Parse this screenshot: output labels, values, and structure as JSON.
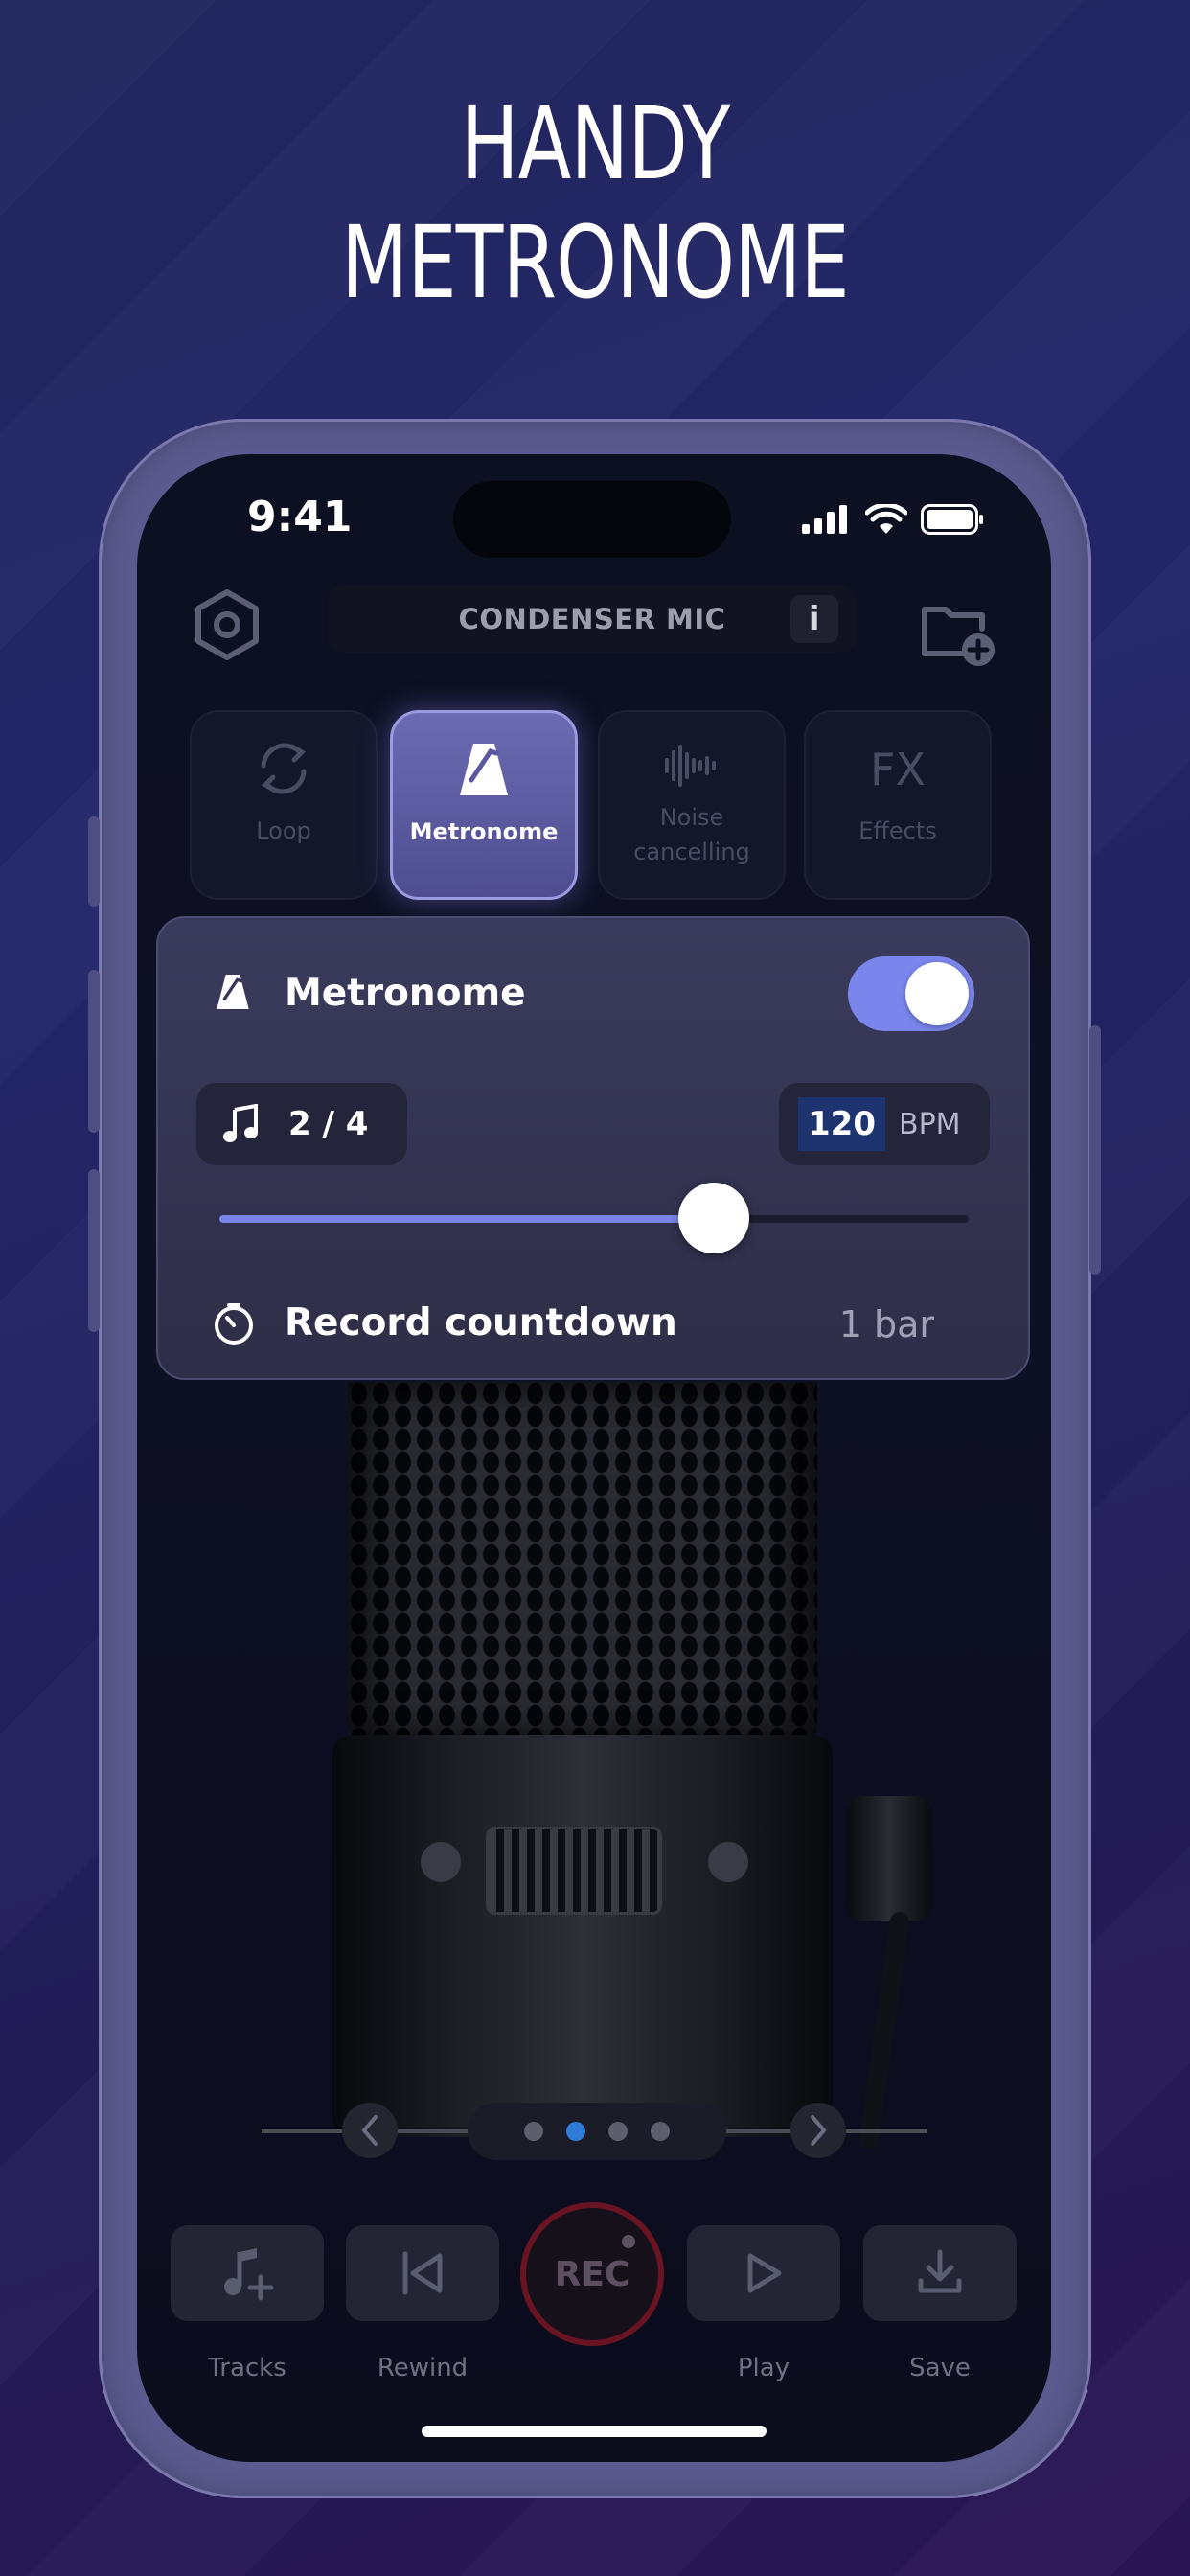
{
  "headline": {
    "line1": "HANDY",
    "line2": "METRONOME"
  },
  "status_bar": {
    "time": "9:41"
  },
  "header": {
    "mic_title": "CONDENSER MIC",
    "info_label": "i"
  },
  "modes": [
    {
      "label": "Loop",
      "icon": "loop-icon",
      "active": false
    },
    {
      "label": "Metronome",
      "icon": "metronome-icon",
      "active": true
    },
    {
      "label": "Noise cancelling",
      "icon": "waveform-icon",
      "active": false
    },
    {
      "label": "Effects",
      "icon": "fx-icon",
      "active": false
    }
  ],
  "metronome_panel": {
    "title": "Metronome",
    "enabled": true,
    "time_signature": "2 / 4",
    "bpm": "120",
    "bpm_unit": "BPM",
    "tempo_slider_fraction": 0.66,
    "countdown_label": "Record countdown",
    "countdown_value": "1 bar"
  },
  "carousel": {
    "page_count": 4,
    "active_index": 1
  },
  "toolbar": {
    "tracks": "Tracks",
    "rewind": "Rewind",
    "rec": "REC",
    "play": "Play",
    "save": "Save"
  },
  "colors": {
    "accent": "#7a86ec",
    "record_ring": "#6a1422",
    "dot_active": "#2f7bd8"
  }
}
